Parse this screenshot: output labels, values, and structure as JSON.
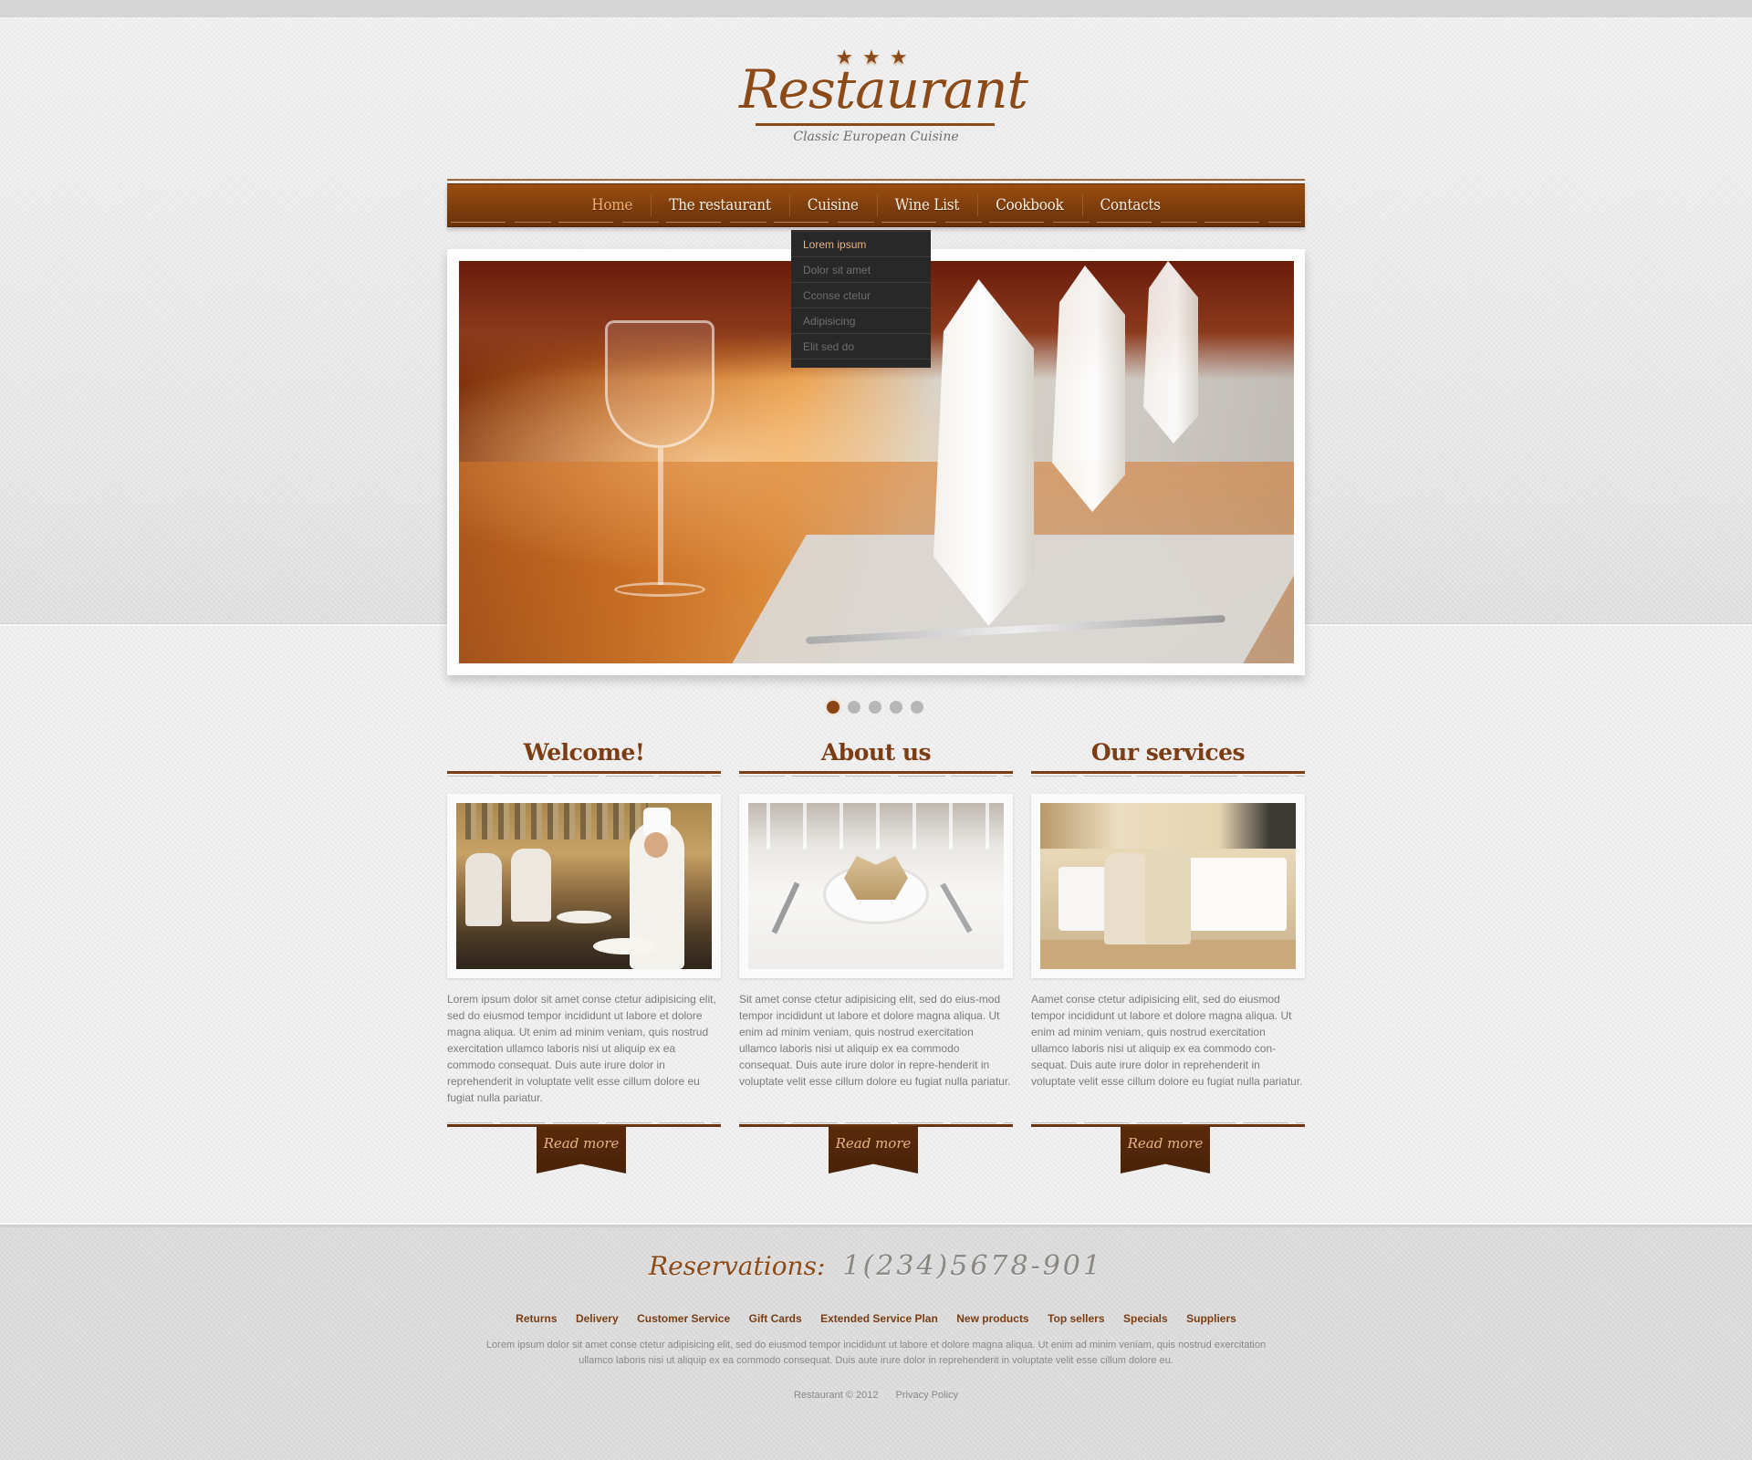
{
  "logo": {
    "stars": "★★★",
    "title": "Restaurant",
    "subtitle": "Classic European Cuisine"
  },
  "nav": {
    "items": [
      {
        "label": "Home",
        "active": true
      },
      {
        "label": "The restaurant",
        "active": false
      },
      {
        "label": "Cuisine",
        "active": false
      },
      {
        "label": "Wine List",
        "active": false
      },
      {
        "label": "Cookbook",
        "active": false
      },
      {
        "label": "Contacts",
        "active": false
      }
    ],
    "dropdown": {
      "parent": "Cuisine",
      "items": [
        {
          "label": "Lorem ipsum",
          "active": true
        },
        {
          "label": "Dolor sit amet",
          "active": false
        },
        {
          "label": "Cconse ctetur",
          "active": false
        },
        {
          "label": "Adipisicing",
          "active": false
        },
        {
          "label": "Elit sed do",
          "active": false
        }
      ]
    }
  },
  "slider": {
    "image": "restaurant-table-setting-photo",
    "slide_count": 5,
    "active_slide": 1
  },
  "columns": [
    {
      "heading": "Welcome!",
      "image": "chefs-in-kitchen-photo",
      "text": "Lorem ipsum dolor sit amet conse ctetur adipisicing elit, sed do eiusmod tempor incididunt ut labore et dolore magna aliqua. Ut enim ad minim veniam, quis nostrud exercitation ullamco laboris nisi ut aliquip ex ea commodo consequat. Duis aute irure dolor in reprehenderit in voluptate velit esse cillum dolore eu fugiat nulla pariatur.",
      "button": "Read more"
    },
    {
      "heading": "About us",
      "image": "white-table-setting-photo",
      "text": "Sit amet conse ctetur adipisicing elit, sed do eius-mod tempor incididunt ut labore et dolore magna aliqua. Ut enim ad minim veniam, quis nostrud exercitation ullamco laboris nisi ut aliquip ex ea commodo consequat. Duis aute irure dolor in repre-henderit in voluptate velit esse cillum dolore eu fugiat nulla pariatur.",
      "button": "Read more"
    },
    {
      "heading": "Our services",
      "image": "dining-room-photo",
      "text": "Aamet conse ctetur adipisicing elit, sed do eiusmod tempor incididunt ut labore et dolore magna aliqua. Ut enim ad minim veniam, quis nostrud exercitation ullamco laboris nisi ut aliquip ex ea commodo con-sequat. Duis aute irure dolor in reprehenderit in voluptate velit esse cillum dolore eu fugiat nulla pariatur.",
      "button": "Read more"
    }
  ],
  "footer": {
    "reservations_label": "Reservations:",
    "phone": "1(234)5678-901",
    "links": [
      "Returns",
      "Delivery",
      "Customer Service",
      "Gift Cards",
      "Extended Service Plan",
      "New products",
      "Top sellers",
      "Specials",
      "Suppliers"
    ],
    "text": "Lorem ipsum dolor sit amet conse ctetur adipisicing elit, sed do eiusmod tempor incididunt ut labore et dolore magna aliqua. Ut enim ad minim veniam, quis nostrud exercitation ullamco laboris nisi ut aliquip ex ea commodo consequat. Duis aute irure dolor in reprehenderit in voluptate velit esse cillum dolore eu.",
    "copyright": "Restaurant © 2012",
    "privacy": "Privacy Policy"
  },
  "colors": {
    "brand_brown": "#8b4a17",
    "nav_bg": "#7c3c0c",
    "nav_active": "#f3b074",
    "dropdown_bg": "#282828",
    "dropdown_active": "#e8b47f",
    "button_bg": "#4a2208",
    "dot_active": "#8b4413",
    "dot_inactive": "#b7b7b7"
  }
}
